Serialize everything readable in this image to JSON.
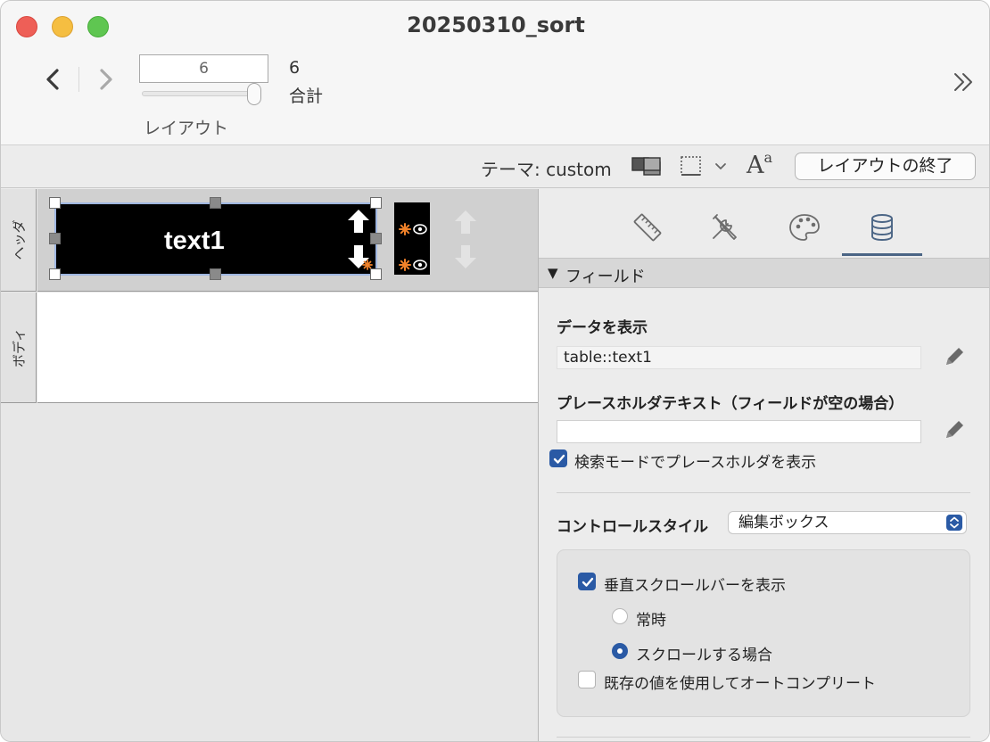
{
  "window": {
    "title": "20250310_sort"
  },
  "toolbar": {
    "record_number": "6",
    "record_count": "6",
    "record_total_label": "合計",
    "layout_label": "レイアウト",
    "slider_position": 1.0
  },
  "layout_bar": {
    "theme_label": "テーマ: custom",
    "font_icon_text": "A",
    "font_icon_sup": "a",
    "exit_button": "レイアウトの終了"
  },
  "canvas": {
    "parts": [
      {
        "label": "ヘッダ"
      },
      {
        "label": "ボディ"
      }
    ],
    "field": {
      "text": "text1"
    }
  },
  "inspector": {
    "tabs": [
      {
        "name": "position",
        "icon": "ruler-icon",
        "active": false
      },
      {
        "name": "styles",
        "icon": "tools-icon",
        "active": false
      },
      {
        "name": "appearance",
        "icon": "palette-icon",
        "active": false
      },
      {
        "name": "data",
        "icon": "database-icon",
        "active": true
      }
    ],
    "section_title": "フィールド",
    "display_data_label": "データを表示",
    "display_data_value": "table::text1",
    "placeholder_label": "プレースホルダテキスト（フィールドが空の場合）",
    "placeholder_value": "",
    "show_placeholder_find_mode": {
      "label": "検索モードでプレースホルダを表示",
      "checked": true
    },
    "control_style_label": "コントロールスタイル",
    "control_style_value": "編集ボックス",
    "vertical_scrollbar": {
      "label": "垂直スクロールバーを表示",
      "checked": true
    },
    "scroll_options": [
      {
        "label": "常時",
        "selected": false
      },
      {
        "label": "スクロールする場合",
        "selected": true
      }
    ],
    "autocomplete": {
      "label": "既存の値を使用してオートコンプリート",
      "checked": false
    }
  },
  "colors": {
    "accent": "#2a5aa5",
    "tab_underline": "#4b6585",
    "badge_orange": "#f0822a"
  }
}
